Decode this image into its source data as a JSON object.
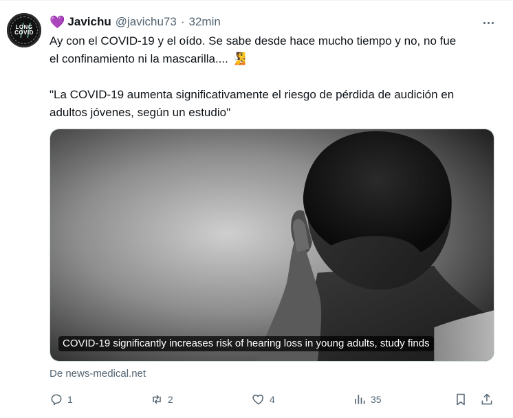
{
  "tweet": {
    "emoji": "💜",
    "author_name": "Javichu",
    "handle": "@javichu73",
    "separator": "·",
    "time": "32min",
    "avatar_text": [
      "LONG",
      "COVID"
    ],
    "text_line1": "Ay con el COVID-19 y el oído. Se sabe desde hace mucho tiempo y no, no fue",
    "text_line2": "el confinamiento ni la mascarilla.... 🧏",
    "quote_line1": "\"La COVID-19 aumenta significativamente el riesgo de pérdida de audición en",
    "quote_line2": "adultos jóvenes, según un estudio\"",
    "card_caption": "COVID-19 significantly increases risk of hearing loss in young adults, study finds",
    "source": "De news-medical.net",
    "actions": {
      "reply_count": "1",
      "retweet_count": "2",
      "like_count": "4",
      "view_count": "35"
    }
  },
  "icons": {
    "more": "more-icon",
    "reply": "reply-icon",
    "retweet": "retweet-icon",
    "like": "heart-icon",
    "views": "views-icon",
    "bookmark": "bookmark-icon",
    "share": "share-icon"
  },
  "colors": {
    "text": "#0f1419",
    "muted": "#536471",
    "border": "#cfd9de",
    "heart_emoji": "#b58be5"
  }
}
